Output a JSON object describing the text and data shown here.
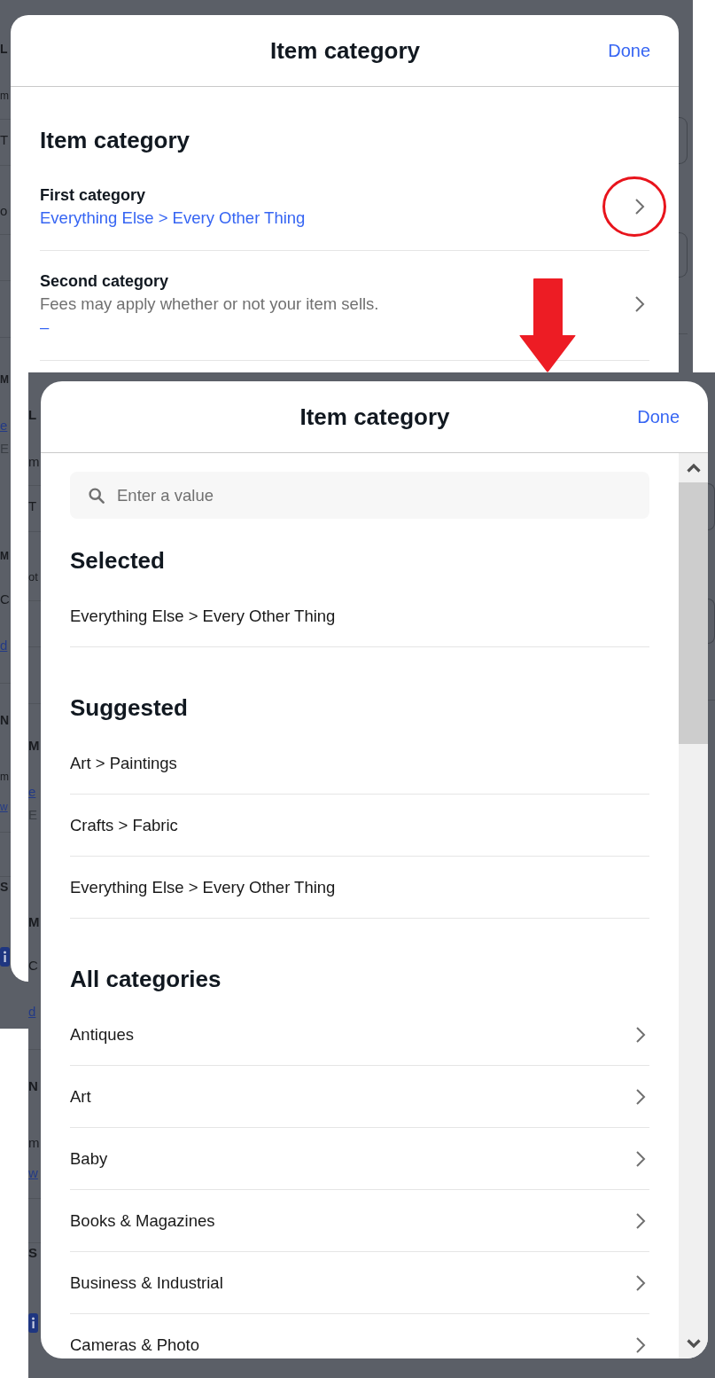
{
  "screenshots": [
    {
      "background": {
        "fragments": [
          {
            "kind": "heading",
            "text": "L"
          },
          {
            "kind": "label",
            "text": "m"
          },
          {
            "kind": "label",
            "text": "T"
          },
          {
            "kind": "label",
            "text": "o"
          },
          {
            "kind": "heading",
            "text": "M"
          },
          {
            "kind": "link",
            "text": "e"
          },
          {
            "kind": "muted",
            "text": "E"
          },
          {
            "kind": "heading",
            "text": "M"
          },
          {
            "kind": "label",
            "text": "C"
          },
          {
            "kind": "link",
            "text": "d"
          },
          {
            "kind": "heading",
            "text": "N"
          },
          {
            "kind": "label",
            "text": "m"
          },
          {
            "kind": "link",
            "text": "w"
          },
          {
            "kind": "heading",
            "text": "S"
          },
          {
            "kind": "info"
          }
        ]
      },
      "dialog": {
        "kind": "summary",
        "title": "Item category",
        "action": "Done",
        "heading": "Item category",
        "fields": [
          {
            "label": "First category",
            "value": "Everything Else > Every Other Thing",
            "circled": true
          },
          {
            "label": "Second category",
            "description": "Fees may apply whether or not your item sells.",
            "value": "–",
            "circled": false
          }
        ]
      }
    },
    {
      "background": {
        "fragments": [
          {
            "kind": "heading",
            "text": "L"
          },
          {
            "kind": "label",
            "text": "m"
          },
          {
            "kind": "label",
            "text": "T"
          },
          {
            "kind": "label",
            "text": "ot"
          },
          {
            "kind": "heading",
            "text": "M"
          },
          {
            "kind": "link",
            "text": "e"
          },
          {
            "kind": "muted",
            "text": "E"
          },
          {
            "kind": "heading",
            "text": "M"
          },
          {
            "kind": "label",
            "text": "C"
          },
          {
            "kind": "link",
            "text": "d"
          },
          {
            "kind": "heading",
            "text": "N"
          },
          {
            "kind": "label",
            "text": "m"
          },
          {
            "kind": "link",
            "text": "w"
          },
          {
            "kind": "heading",
            "text": "S"
          },
          {
            "kind": "info"
          }
        ]
      },
      "dialog": {
        "kind": "picker",
        "title": "Item category",
        "action": "Done",
        "search": {
          "placeholder": "Enter a value"
        },
        "sections": [
          {
            "title": "Selected",
            "kind": "plain",
            "items": [
              {
                "label": "Everything Else > Every Other Thing"
              }
            ]
          },
          {
            "title": "Suggested",
            "kind": "plain",
            "items": [
              {
                "label": "Art > Paintings"
              },
              {
                "label": "Crafts > Fabric"
              },
              {
                "label": "Everything Else > Every Other Thing"
              }
            ]
          },
          {
            "title": "All categories",
            "kind": "browse",
            "items": [
              {
                "label": "Antiques"
              },
              {
                "label": "Art"
              },
              {
                "label": "Baby"
              },
              {
                "label": "Books & Magazines"
              },
              {
                "label": "Business & Industrial"
              },
              {
                "label": "Cameras & Photo"
              }
            ]
          }
        ]
      }
    }
  ]
}
